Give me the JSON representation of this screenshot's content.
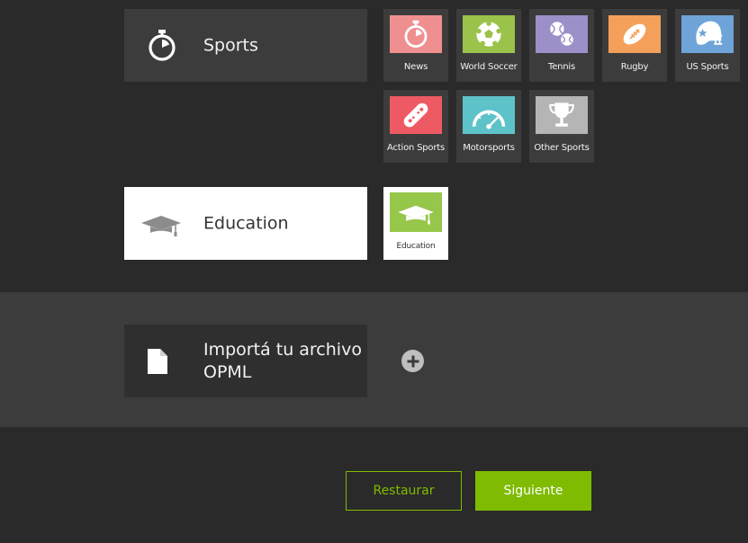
{
  "categories": {
    "sports": {
      "label": "Sports",
      "icon": "stopwatch-icon"
    },
    "education": {
      "label": "Education",
      "icon": "graduation-cap-icon"
    }
  },
  "sports_tiles": [
    {
      "label": "News",
      "icon": "stopwatch-icon",
      "color": "#f08f8f"
    },
    {
      "label": "World Soccer",
      "icon": "soccer-ball-icon",
      "color": "#9bc24a"
    },
    {
      "label": "Tennis",
      "icon": "tennis-balls-icon",
      "color": "#9d8fc8"
    },
    {
      "label": "Rugby",
      "icon": "rugby-ball-icon",
      "color": "#f5a05a"
    },
    {
      "label": "US Sports",
      "icon": "football-helmet-icon",
      "color": "#6fa4d8"
    },
    {
      "label": "Action Sports",
      "icon": "skateboard-icon",
      "color": "#ee5a63"
    },
    {
      "label": "Motorsports",
      "icon": "speedometer-icon",
      "color": "#5ec3c9"
    },
    {
      "label": "Other Sports",
      "icon": "trophy-icon",
      "color": "#b5b5b5"
    }
  ],
  "education_tiles": [
    {
      "label": "Education",
      "icon": "graduation-cap-icon",
      "color": "#96c64a"
    }
  ],
  "import": {
    "label": "Importá tu archivo OPML",
    "icon": "document-icon",
    "add_icon": "plus-circle-icon"
  },
  "buttons": {
    "restore": "Restaurar",
    "next": "Siguiente"
  },
  "colors": {
    "accent": "#7fbb00",
    "background": "#2a2a2a",
    "panel": "#3c3c3c"
  }
}
